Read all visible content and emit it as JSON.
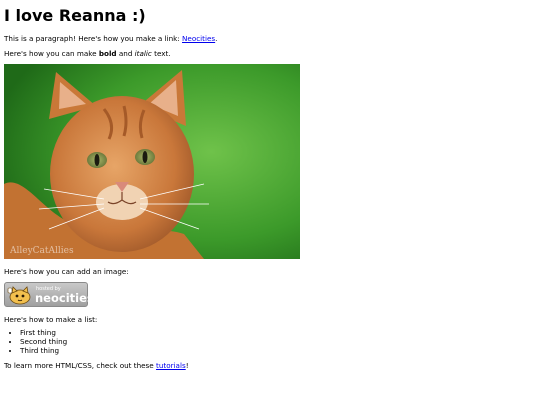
{
  "heading": "I love Reanna :)",
  "para1": {
    "text": "This is a paragraph! Here's how you make a link: ",
    "link": "Neocities",
    "after": "."
  },
  "para2": {
    "before": "Here's how you can make ",
    "bold": "bold",
    "middle": " and ",
    "italic": "italic",
    "after": " text."
  },
  "image": {
    "alt": "cat photo",
    "watermark": "AlleyCatAllies"
  },
  "image_caption": "Here's how you can add an image:",
  "badge": {
    "small_text": "hosted by",
    "big_text": "neocities"
  },
  "list_intro": "Here's how to make a list:",
  "list_items": [
    "First thing",
    "Second thing",
    "Third thing"
  ],
  "footer": {
    "before": "To learn more HTML/CSS, check out these ",
    "link": "tutorials",
    "after": "!"
  },
  "colors": {
    "link": "#0000ee",
    "grass": "#3fa32e",
    "fur": "#d4803f"
  }
}
